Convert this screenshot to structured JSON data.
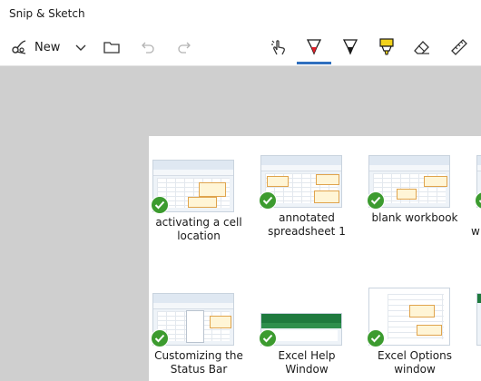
{
  "window": {
    "title": "Snip & Sketch"
  },
  "toolbar": {
    "new_label": "New",
    "tools": [
      {
        "name": "touch-writing",
        "icon": "touch-writing-icon",
        "active": false
      },
      {
        "name": "ballpoint-pen",
        "icon": "ballpoint-pen-icon",
        "active": true,
        "color": "#e0202a"
      },
      {
        "name": "pencil",
        "icon": "pencil-icon",
        "active": false,
        "color": "#1a1a1a"
      },
      {
        "name": "highlighter",
        "icon": "highlighter-icon",
        "active": false,
        "color": "#f2d21b"
      },
      {
        "name": "eraser",
        "icon": "eraser-icon",
        "active": false
      },
      {
        "name": "ruler",
        "icon": "ruler-icon",
        "active": false
      }
    ]
  },
  "files": [
    {
      "label": "activating a cell\nlocation",
      "checked": true
    },
    {
      "label": "annotated\nspreadsheet 1",
      "checked": true
    },
    {
      "label": "blank workbook",
      "checked": true
    },
    {
      "label": "w",
      "checked": true
    },
    {
      "label": "Customizing the\nStatus Bar",
      "checked": true
    },
    {
      "label": "Excel Help\nWindow",
      "checked": true
    },
    {
      "label": "Excel Options\nwindow",
      "checked": true
    }
  ],
  "colors": {
    "accent": "#2f6fbf",
    "check": "#3c9b2f",
    "canvas": "#cfcfcf"
  }
}
